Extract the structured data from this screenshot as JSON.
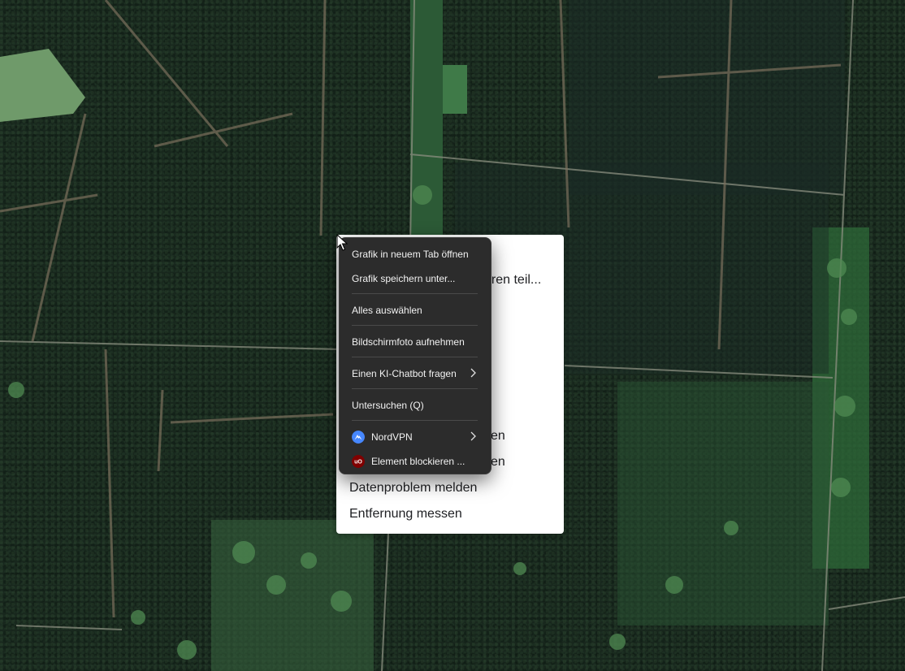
{
  "maps_menu": {
    "partial_items": [
      "eren teil...",
      "en",
      "en"
    ],
    "items": [
      "Datenproblem melden",
      "Entfernung messen"
    ]
  },
  "context_menu": {
    "items": [
      {
        "label": "Grafik in neuem Tab öffnen"
      },
      {
        "label": "Grafik speichern unter..."
      },
      {
        "label": "Alles auswählen"
      },
      {
        "label": "Bildschirmfoto aufnehmen"
      },
      {
        "label": "Einen KI-Chatbot fragen",
        "submenu": true
      },
      {
        "label": "Untersuchen (Q)"
      },
      {
        "label": "NordVPN",
        "icon": "nordvpn-icon",
        "submenu": true
      },
      {
        "label": "Element blockieren ...",
        "icon": "ublock-origin-icon"
      }
    ]
  },
  "colors": {
    "menu_bg": "#2c2c2c",
    "menu_text": "#f2f2f2",
    "nordvpn_blue": "#4687ff",
    "ublock_red": "#800000"
  }
}
